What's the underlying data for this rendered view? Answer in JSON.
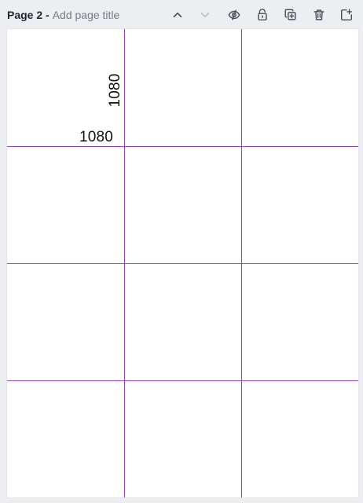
{
  "header": {
    "page_label": "Page 2 -",
    "title_placeholder": "Add page title"
  },
  "toolbar": {
    "buttons": [
      {
        "name": "move-page-up",
        "icon": "chevron-up-icon",
        "state": "enabled"
      },
      {
        "name": "move-page-down",
        "icon": "chevron-down-icon",
        "state": "disabled"
      },
      {
        "name": "hide-page",
        "icon": "eye-off-icon",
        "state": "enabled"
      },
      {
        "name": "lock-page",
        "icon": "lock-icon",
        "state": "enabled"
      },
      {
        "name": "duplicate-page",
        "icon": "duplicate-icon",
        "state": "enabled"
      },
      {
        "name": "delete-page",
        "icon": "trash-icon",
        "state": "enabled"
      },
      {
        "name": "add-page",
        "icon": "add-page-icon",
        "state": "enabled"
      }
    ]
  },
  "canvas": {
    "grid_columns": 3,
    "grid_rows": 4,
    "dimensions": {
      "width_label": "1080",
      "height_label": "1080"
    }
  },
  "colors": {
    "background": "#edeef2",
    "canvas": "#ffffff",
    "guide": "#8e3bdb",
    "text_primary": "#1f2430",
    "text_muted": "#767b87"
  }
}
